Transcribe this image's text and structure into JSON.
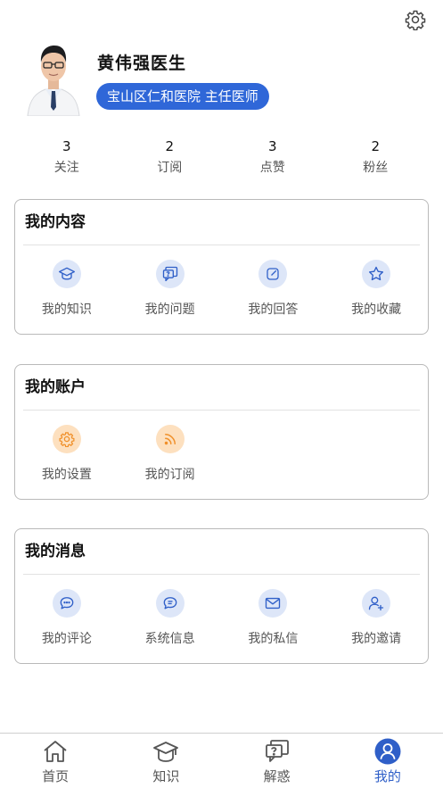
{
  "profile": {
    "name": "黄伟强医生",
    "badge": "宝山区仁和医院 主任医师"
  },
  "stats": [
    {
      "value": "3",
      "label": "关注"
    },
    {
      "value": "2",
      "label": "订阅"
    },
    {
      "value": "3",
      "label": "点赞"
    },
    {
      "value": "2",
      "label": "粉丝"
    }
  ],
  "sections": {
    "content": {
      "title": "我的内容",
      "items": [
        {
          "label": "我的知识",
          "icon": "graduation-cap-icon"
        },
        {
          "label": "我的问题",
          "icon": "question-board-icon"
        },
        {
          "label": "我的回答",
          "icon": "edit-icon"
        },
        {
          "label": "我的收藏",
          "icon": "star-icon"
        }
      ]
    },
    "account": {
      "title": "我的账户",
      "items": [
        {
          "label": "我的设置",
          "icon": "gear-icon"
        },
        {
          "label": "我的订阅",
          "icon": "rss-icon"
        }
      ]
    },
    "messages": {
      "title": "我的消息",
      "items": [
        {
          "label": "我的评论",
          "icon": "chat-bubbles-icon"
        },
        {
          "label": "系统信息",
          "icon": "message-icon"
        },
        {
          "label": "我的私信",
          "icon": "envelope-icon"
        },
        {
          "label": "我的邀请",
          "icon": "add-user-icon"
        }
      ]
    }
  },
  "tabbar": [
    {
      "label": "首页",
      "icon": "home-icon"
    },
    {
      "label": "知识",
      "icon": "graduation-cap-icon"
    },
    {
      "label": "解惑",
      "icon": "question-board-icon"
    },
    {
      "label": "我的",
      "icon": "user-icon",
      "active": true
    }
  ],
  "colors": {
    "accent": "#2f67d8",
    "icon_blue": "#2f5fc8",
    "icon_blue_bg": "#dde6f8",
    "icon_orange": "#f0902a",
    "icon_orange_bg": "#fde0bf"
  }
}
